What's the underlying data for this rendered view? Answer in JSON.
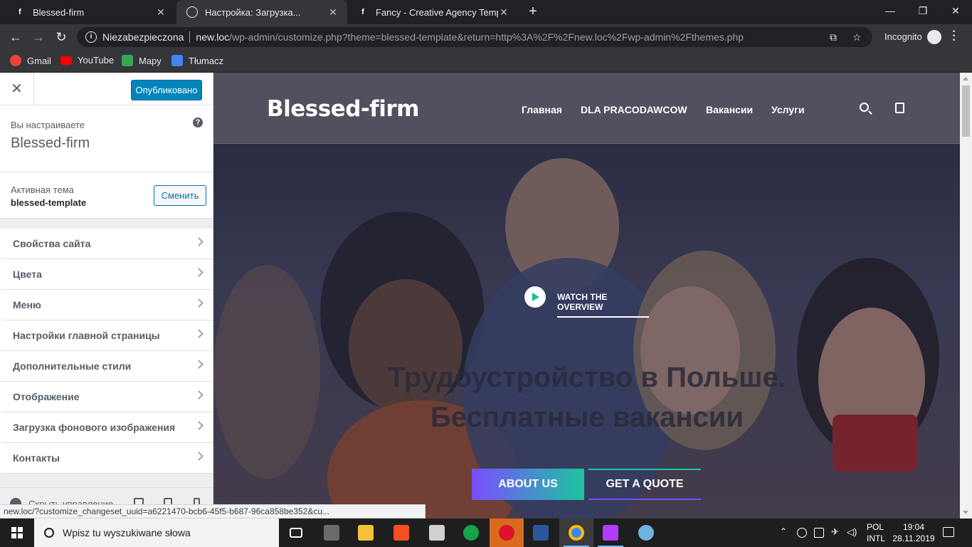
{
  "browser": {
    "tabs": [
      {
        "title": "Blessed-firm",
        "icon": "facebook-icon",
        "active": false
      },
      {
        "title": "Настройка: Загрузка...",
        "icon": "globe-icon",
        "active": true
      },
      {
        "title": "Fancy - Creative Agency Templat",
        "icon": "facebook-icon",
        "active": false
      }
    ],
    "new_tab": "+",
    "omnibox": {
      "security": "Niezabezpieczona",
      "host": "new.loc",
      "path": "/wp-admin/customize.php?theme=blessed-template&return=http%3A%2F%2Fnew.loc%2Fwp-admin%2Fthemes.php"
    },
    "incognito_label": "Incognito",
    "bookmarks": [
      {
        "label": "Gmail",
        "icon": "google-icon",
        "color": "#ea4335"
      },
      {
        "label": "YouTube",
        "icon": "youtube-icon",
        "color": "#ff0000"
      },
      {
        "label": "Mapy",
        "icon": "maps-icon",
        "color": "#34a853"
      },
      {
        "label": "Tłumacz",
        "icon": "translate-icon",
        "color": "#4285f4"
      }
    ],
    "status_url": "new.loc/?customize_changeset_uuid=a6221470-bcb6-45f5-b687-96ca858be352&cu..."
  },
  "customizer": {
    "publish_label": "Опубликовано",
    "customizing_label": "Вы настраиваете",
    "site_name": "Blessed-firm",
    "active_theme_label": "Активная тема",
    "active_theme_name": "blessed-template",
    "change_label": "Сменить",
    "sections": [
      "Свойства сайта",
      "Цвета",
      "Меню",
      "Настройки главной страницы",
      "Дополнительные стили",
      "Отображение",
      "Загрузка фонового изображения",
      "Контакты"
    ],
    "hide_controls_label": "Скрыть управление"
  },
  "preview": {
    "logo": "Blessed-firm",
    "nav": [
      "Главная",
      "DLA PRACODAWCOW",
      "Вакансии",
      "Услуги"
    ],
    "watch_label": "WATCH THE OVERVIEW",
    "headline_line1": "Трудоустройство в Польше.",
    "headline_line2": "Бесплатные вакансии",
    "about_label": "ABOUT US",
    "quote_label": "GET A QUOTE"
  },
  "taskbar": {
    "search_placeholder": "Wpisz tu wyszukiwane słowa",
    "lang_top": "POL",
    "lang_bottom": "INTL",
    "time": "19:04",
    "date": "28.11.2019"
  }
}
